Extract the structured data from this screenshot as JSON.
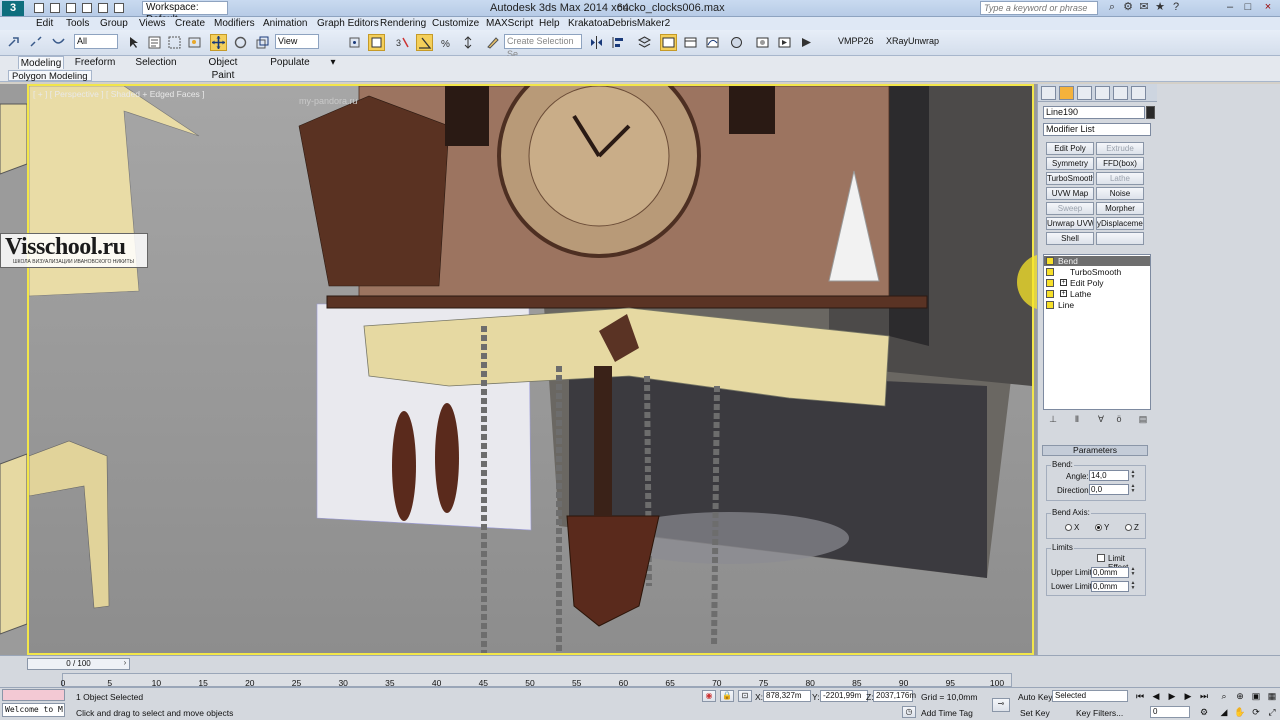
{
  "titlebar": {
    "app_logo": "3",
    "workspace": "Workspace: Default",
    "app_title": "Autodesk 3ds Max  2014 x64",
    "file_title": "cucko_clocks006.max",
    "search_placeholder": "Type a keyword or phrase",
    "minimize": "–",
    "maximize": "□",
    "close": "×"
  },
  "menu": [
    "Edit",
    "Tools",
    "Group",
    "Views",
    "Create",
    "Modifiers",
    "Animation",
    "Graph Editors",
    "Rendering",
    "Customize",
    "MAXScript",
    "Help",
    "Krakatoa",
    "DebrisMaker2"
  ],
  "toolbar": {
    "selection_filter": "All",
    "ref_coord": "View",
    "named_selection": "Create Selection Se",
    "vmpp": "VMPP26",
    "xray": "XRayUnwrap"
  },
  "ribbon": {
    "tabs": [
      "Modeling",
      "Freeform",
      "Selection",
      "Object Paint",
      "Populate"
    ],
    "active_tab": "Modeling",
    "sub_panel": "Polygon Modeling",
    "dropdown": "▾"
  },
  "viewport": {
    "label": "[ + ] [ Perspective ] [ Shaded + Edged Faces ]",
    "watermark": "my-pandora.ru",
    "logo_main": "Visschool.ru",
    "logo_sub": "ШКОЛА ВИЗУАЛИЗАЦИИ ИВАНОВСКОГО НИКИТЫ"
  },
  "command_panel": {
    "object_name": "Line190",
    "modifier_list": "Modifier List",
    "buttons": [
      {
        "label": "Edit Poly",
        "enabled": true
      },
      {
        "label": "Extrude",
        "enabled": false
      },
      {
        "label": "Symmetry",
        "enabled": true
      },
      {
        "label": "FFD(box)",
        "enabled": true
      },
      {
        "label": "TurboSmooth",
        "enabled": true
      },
      {
        "label": "Lathe",
        "enabled": false
      },
      {
        "label": "UVW Map",
        "enabled": true
      },
      {
        "label": "Noise",
        "enabled": true
      },
      {
        "label": "Sweep",
        "enabled": false
      },
      {
        "label": "Morpher",
        "enabled": true
      },
      {
        "label": "Unwrap UVW",
        "enabled": true
      },
      {
        "label": "yDisplacement",
        "enabled": true
      },
      {
        "label": "Shell",
        "enabled": true
      },
      {
        "label": "",
        "enabled": true
      }
    ],
    "stack": [
      {
        "label": "Bend",
        "selected": true,
        "expandable": false
      },
      {
        "label": "TurboSmooth",
        "selected": false,
        "expandable": false
      },
      {
        "label": "Edit Poly",
        "selected": false,
        "expandable": true
      },
      {
        "label": "Lathe",
        "selected": false,
        "expandable": true
      },
      {
        "label": "Line",
        "selected": false,
        "expandable": false
      }
    ],
    "parameters": {
      "title": "Parameters",
      "bend_group": "Bend:",
      "angle_label": "Angle:",
      "angle_value": "14,0",
      "direction_label": "Direction:",
      "direction_value": "0,0",
      "axis_group": "Bend Axis:",
      "axis_x": "X",
      "axis_y": "Y",
      "axis_z": "Z",
      "selected_axis": "Y",
      "limits_group": "Limits",
      "limit_effect": "Limit Effect",
      "upper_label": "Upper Limit:",
      "upper_value": "0,0mm",
      "lower_label": "Lower Limit:",
      "lower_value": "0,0mm"
    }
  },
  "timeline": {
    "frame_slider": "0 / 100",
    "ticks": [
      "5",
      "10",
      "15",
      "20",
      "25",
      "30",
      "35",
      "40",
      "45",
      "50",
      "55",
      "60",
      "65",
      "70",
      "75",
      "80",
      "85",
      "90",
      "95",
      "100"
    ],
    "tick_zero": "0"
  },
  "status": {
    "maxscript_listener": "Welcome to M",
    "selection_info": "1 Object Selected",
    "prompt": "Click and drag to select and move objects",
    "x_label": "X:",
    "x_value": "878,327m",
    "y_label": "Y:",
    "y_value": "-2201,99m",
    "z_label": "Z:",
    "z_value": "2037,176m",
    "grid": "Grid = 10,0mm",
    "add_time_tag": "Add Time Tag",
    "auto_key": "Auto Key",
    "set_key": "Set Key",
    "key_mode": "Selected",
    "key_filters": "Key Filters...",
    "current_frame": "0"
  },
  "colors": {
    "viewport_border": "#f2e64a",
    "highlight": "#f8e628",
    "titlebar": "#c9daf0"
  }
}
